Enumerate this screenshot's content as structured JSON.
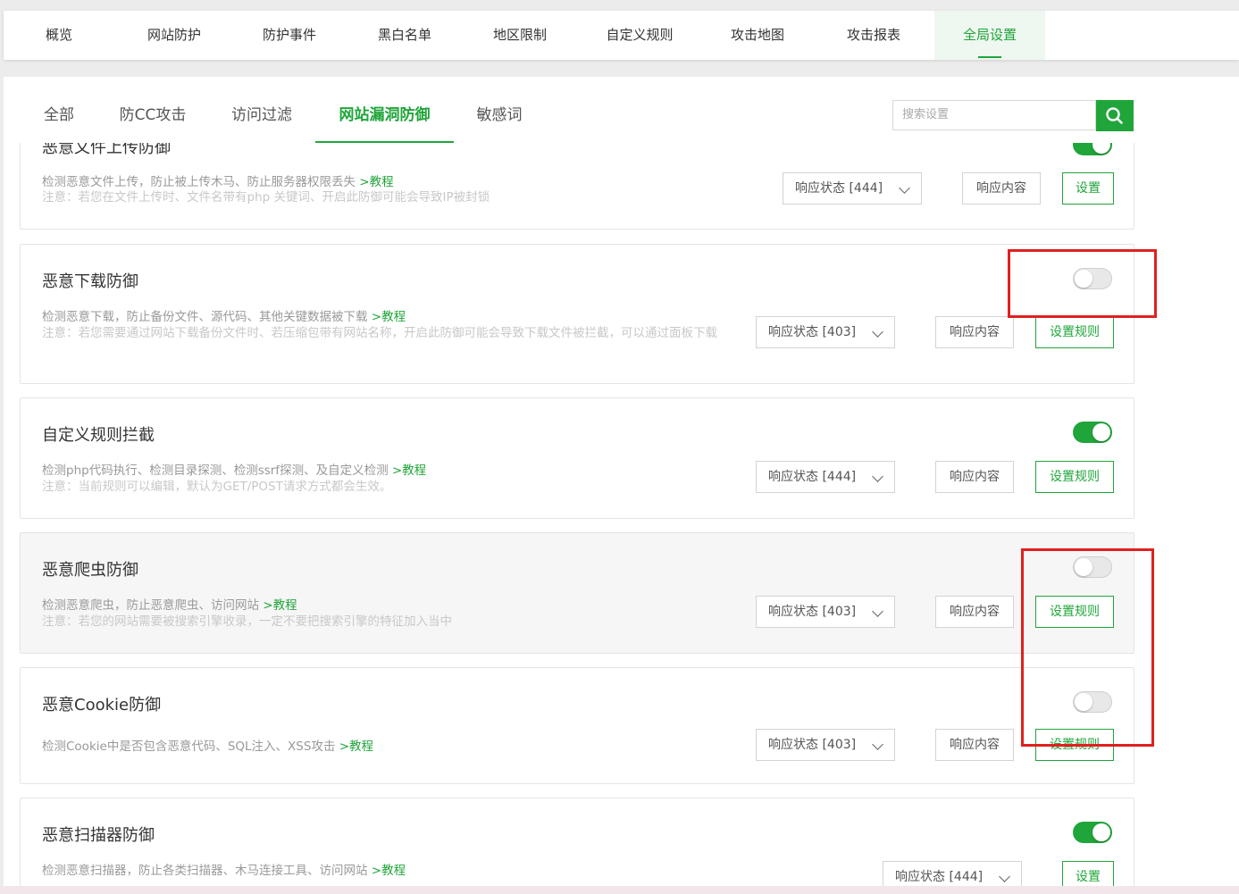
{
  "top_nav": [
    "概览",
    "网站防护",
    "防护事件",
    "黑白名单",
    "地区限制",
    "自定义规则",
    "攻击地图",
    "攻击报表",
    "全局设置"
  ],
  "sub_tabs": [
    "全部",
    "防CC攻击",
    "访问过滤",
    "网站漏洞防御",
    "敏感词"
  ],
  "search": {
    "placeholder": "搜索设置"
  },
  "colors": {
    "accent": "#20a53a",
    "highlight_box": "#e02020"
  },
  "cards": [
    {
      "title": "恶意文件上传防御",
      "desc": "检测恶意文件上传，防止被上传木马、防止服务器权限丢失",
      "link": ">教程",
      "note": "注意：若您在文件上传时、文件名带有php 关键词、开启此防御可能会导致IP被封锁",
      "status": "响应状态 [444]",
      "response_label": "响应内容",
      "settings_label": "设置",
      "enabled": true
    },
    {
      "title": "恶意下载防御",
      "desc": "检测恶意下载，防止备份文件、源代码、其他关键数据被下载",
      "link": ">教程",
      "note": "注意：若您需要通过网站下载备份文件时、若压缩包带有网站名称，开启此防御可能会导致下载文件被拦截，可以通过面板下载",
      "status": "响应状态 [403]",
      "response_label": "响应内容",
      "settings_label": "设置规则",
      "enabled": false
    },
    {
      "title": "自定义规则拦截",
      "desc": "检测php代码执行、检测目录探测、检测ssrf探测、及自定义检测",
      "link": ">教程",
      "note": "注意：当前规则可以编辑，默认为GET/POST请求方式都会生效。",
      "status": "响应状态 [444]",
      "response_label": "响应内容",
      "settings_label": "设置规则",
      "enabled": true
    },
    {
      "title": "恶意爬虫防御",
      "desc": "检测恶意爬虫，防止恶意爬虫、访问网站",
      "link": ">教程",
      "note": "注意：若您的网站需要被搜索引擎收录，一定不要把搜索引擎的特征加入当中",
      "status": "响应状态 [403]",
      "response_label": "响应内容",
      "settings_label": "设置规则",
      "enabled": false
    },
    {
      "title": "恶意Cookie防御",
      "desc": "检测Cookie中是否包含恶意代码、SQL注入、XSS攻击",
      "link": ">教程",
      "note": "",
      "status": "响应状态 [403]",
      "response_label": "响应内容",
      "settings_label": "设置规则",
      "enabled": false
    },
    {
      "title": "恶意扫描器防御",
      "desc": "检测恶意扫描器，防止各类扫描器、木马连接工具、访问网站",
      "link": ">教程",
      "note": "",
      "status": "响应状态 [444]",
      "response_label": "响应内容",
      "settings_label": "设置",
      "enabled": true
    }
  ]
}
